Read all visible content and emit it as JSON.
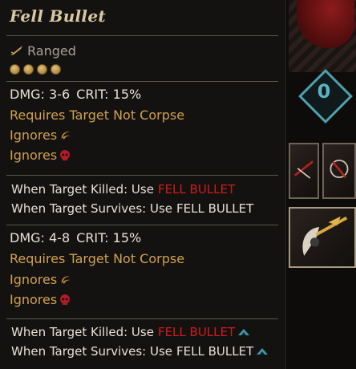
{
  "skill": {
    "title": "Fell Bullet",
    "type": "Ranged",
    "rank_pips": 4,
    "variant1": {
      "dmg": "DMG: 3-6",
      "crit": "CRIT: 15%",
      "requires": "Requires Target Not Corpse",
      "ignores1": "Ignores",
      "ignores1_icon": "stealth-icon",
      "ignores2": "Ignores",
      "ignores2_icon": "skull-icon",
      "killed_prefix": "When Target Killed: Use",
      "killed_skill": "FELL BULLET",
      "survives_prefix": "When Target Survives: Use",
      "survives_skill": "FELL BULLET"
    },
    "variant2": {
      "dmg": "DMG: 4-8",
      "crit": "CRIT: 15%",
      "requires": "Requires Target Not Corpse",
      "ignores1": "Ignores",
      "ignores1_icon": "stealth-icon",
      "ignores2": "Ignores",
      "ignores2_icon": "skull-icon",
      "killed_prefix": "When Target Killed: Use",
      "killed_skill": "FELL BULLET",
      "survives_prefix": "When Target Survives: Use",
      "survives_skill": "FELL BULLET"
    }
  },
  "side": {
    "counter": "0"
  },
  "colors": {
    "title": "#d9c8a2",
    "gold": "#cfa14f",
    "red": "#d11b1b",
    "teal": "#4fa0aa",
    "text": "#e6e1d6"
  }
}
